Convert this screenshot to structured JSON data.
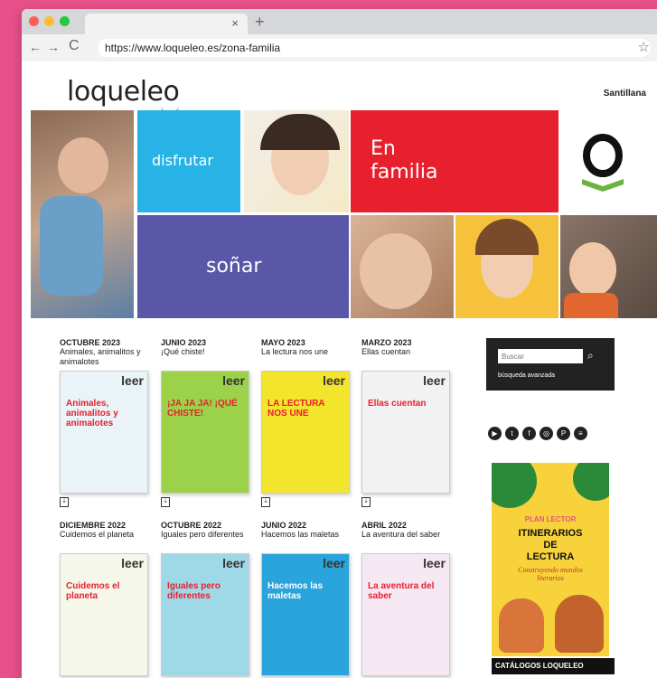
{
  "browser": {
    "url": "https://www.loqueleo.es/zona-familia",
    "tab_close": "×",
    "newtab": "+",
    "back": "←",
    "forward": "→",
    "reload": "C",
    "star": "☆"
  },
  "header": {
    "logo": "loqueleo",
    "brand": "Santillana"
  },
  "hero": {
    "disfrutar": "disfrutar",
    "en_familia_1": "En",
    "en_familia_2": "familia",
    "sonar": "soñar"
  },
  "issues": [
    {
      "date": "OCTUBRE 2023",
      "title": "Animales, animalitos y animalotes",
      "cover_title": "Animales, animalitos y animalotes",
      "color": "#e9f3f8"
    },
    {
      "date": "JUNIO 2023",
      "title": "¡Qué chiste!",
      "cover_title": "¡JA JA JA! ¡QUÉ CHISTE!",
      "color": "#9bd24a"
    },
    {
      "date": "MAYO 2023",
      "title": "La lectura nos une",
      "cover_title": "LA LECTURA NOS UNE",
      "color": "#f3e52b"
    },
    {
      "date": "MARZO 2023",
      "title": "Ellas cuentan",
      "cover_title": "Ellas cuentan",
      "color": "#f2f2f2"
    },
    {
      "date": "DICIEMBRE 2022",
      "title": "Cuidemos el planeta",
      "cover_title": "Cuidemos el planeta",
      "color": "#f4f7ea"
    },
    {
      "date": "OCTUBRE 2022",
      "title": "Iguales pero diferentes",
      "cover_title": "Iguales pero diferentes",
      "color": "#9fd8e6"
    },
    {
      "date": "JUNIO 2022",
      "title": "Hacemos las maletas",
      "cover_title": "Hacemos las maletas",
      "color": "#29a4dc"
    },
    {
      "date": "ABRIL 2022",
      "title": "La aventura del saber",
      "cover_title": "La aventura del saber",
      "color": "#f6e8f2"
    }
  ],
  "cover_brand": "leer",
  "download_glyph": "⇣",
  "sidebar": {
    "search_placeholder": "Buscar",
    "search_icon": "⌕",
    "advanced": "búsqueda avanzada",
    "socials": [
      "▶",
      "t",
      "f",
      "◎",
      "P",
      "≡"
    ],
    "promo_tag": "PLAN LECTOR",
    "promo_title_1": "ITINERARIOS",
    "promo_title_2": "DE",
    "promo_title_3": "LECTURA",
    "promo_sub": "Construyendo mundos literarios",
    "catalog": "CATÁLOGOS LOQUELEO"
  },
  "colors": {
    "pink": "#e9508a",
    "blue": "#27b3e6",
    "red": "#e8202e",
    "purple": "#5a56a8",
    "green": "#6cb33f"
  }
}
